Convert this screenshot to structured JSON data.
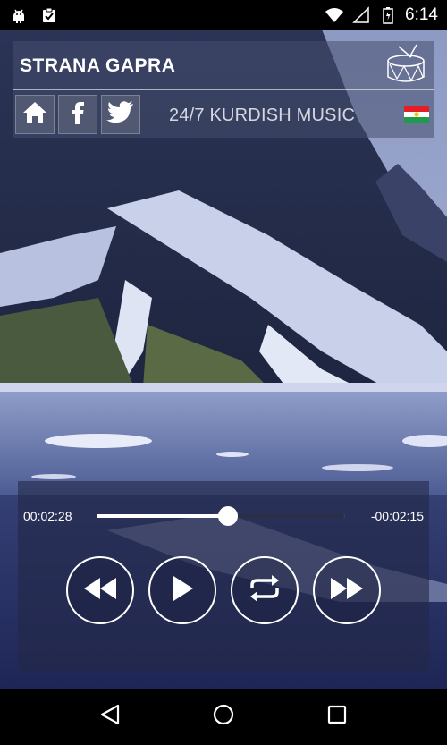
{
  "status_bar": {
    "time": "6:14",
    "left_icons": [
      "android-icon",
      "clipboard-icon"
    ],
    "right_icons": [
      "wifi-icon",
      "signal-icon",
      "battery-icon"
    ]
  },
  "header": {
    "title": "STRANA GAPRA",
    "tagline": "24/7 KURDISH MUSIC",
    "logo_icon": "drum-icon",
    "flag_icon": "kurdistan-flag-icon",
    "social": [
      {
        "name": "home",
        "icon": "home-icon"
      },
      {
        "name": "facebook",
        "icon": "facebook-icon"
      },
      {
        "name": "twitter",
        "icon": "twitter-icon"
      }
    ]
  },
  "player": {
    "elapsed": "00:02:28",
    "remaining": "-00:02:15",
    "progress_percent": 53,
    "controls": [
      {
        "name": "rewind",
        "icon": "rewind-icon"
      },
      {
        "name": "play",
        "icon": "play-icon"
      },
      {
        "name": "repeat",
        "icon": "repeat-icon"
      },
      {
        "name": "fast-forward",
        "icon": "fast-forward-icon"
      }
    ]
  },
  "nav_bar": {
    "buttons": [
      "back-icon",
      "home-circle-icon",
      "recents-icon"
    ]
  },
  "colors": {
    "panel": "#464e6e",
    "accent": "#ffffff",
    "flag_red": "#e31e24",
    "flag_green": "#1e9a48",
    "flag_sun": "#f7c600"
  }
}
